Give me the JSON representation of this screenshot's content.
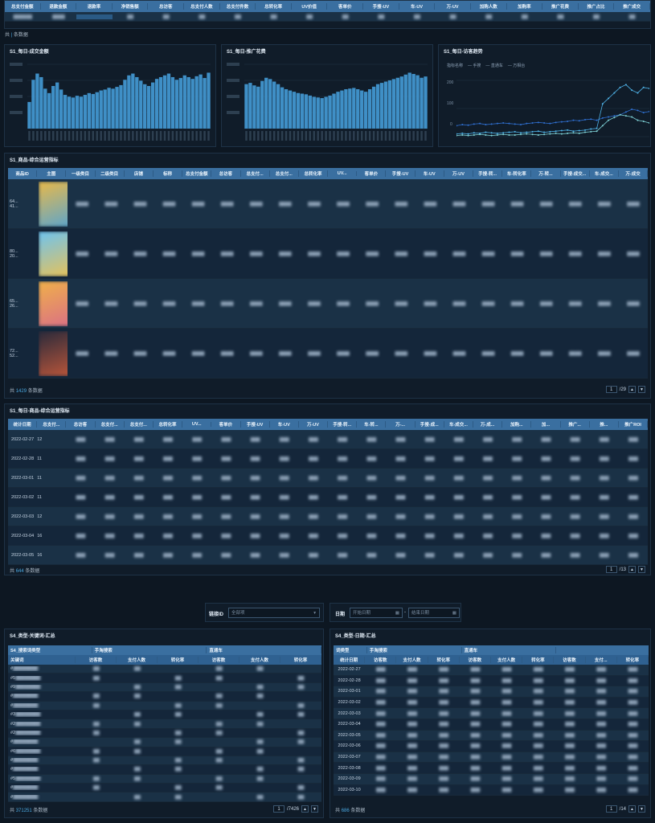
{
  "top_table": {
    "headers": [
      "总支付金额",
      "退款金额",
      "退款率",
      "净销售额",
      "总访客",
      "总支付人数",
      "总支付件数",
      "总转化率",
      "UV价值",
      "客单价",
      "手搜-UV",
      "车-UV",
      "万-UV",
      "加购人数",
      "加购率",
      "推广花费",
      "推广占比",
      "推广成交"
    ],
    "footer_prefix": "共",
    "footer_suffix": "条数据"
  },
  "chart1": {
    "title": "S1_每日-成交金额"
  },
  "chart2": {
    "title": "S1_每日-推广花费"
  },
  "chart3": {
    "title": "S1_每日-访客趋势",
    "legend_title": "指标名称",
    "legend": [
      "手搜",
      "直通车",
      "万相台"
    ],
    "y_ticks": [
      "0",
      "100",
      "200"
    ]
  },
  "chart_data": [
    {
      "type": "bar",
      "title": "S1_每日-成交金额",
      "values": [
        30,
        55,
        62,
        58,
        45,
        40,
        48,
        52,
        44,
        38,
        36,
        35,
        37,
        36,
        38,
        40,
        39,
        41,
        43,
        44,
        46,
        45,
        47,
        49,
        55,
        60,
        62,
        58,
        54,
        50,
        48,
        52,
        56,
        58,
        60,
        62,
        58,
        55,
        57,
        60,
        58,
        56,
        59,
        61,
        57,
        63
      ]
    },
    {
      "type": "bar",
      "title": "S1_每日-推广花费",
      "values": [
        70,
        72,
        68,
        66,
        75,
        80,
        78,
        74,
        70,
        65,
        62,
        60,
        58,
        56,
        55,
        54,
        52,
        50,
        49,
        48,
        50,
        52,
        55,
        58,
        60,
        62,
        63,
        64,
        62,
        60,
        58,
        62,
        66,
        70,
        72,
        74,
        76,
        78,
        80,
        82,
        85,
        88,
        86,
        84,
        80,
        82
      ]
    },
    {
      "type": "line",
      "title": "S1_每日-访客趋势",
      "series": [
        {
          "name": "手搜",
          "values": [
            20,
            22,
            21,
            23,
            24,
            22,
            23,
            24,
            25,
            24,
            23,
            22,
            24,
            25,
            26,
            25,
            24,
            26,
            27,
            28,
            30,
            29,
            31,
            32,
            30,
            34,
            36,
            38,
            40,
            45,
            50,
            48,
            44,
            46
          ]
        },
        {
          "name": "直通车",
          "values": [
            5,
            6,
            5,
            7,
            6,
            8,
            7,
            6,
            7,
            8,
            9,
            7,
            8,
            9,
            10,
            8,
            9,
            10,
            11,
            12,
            10,
            11,
            12,
            14,
            15,
            60,
            70,
            80,
            90,
            95,
            85,
            80,
            90,
            88
          ]
        },
        {
          "name": "万相台",
          "values": [
            2,
            3,
            2,
            3,
            4,
            3,
            2,
            3,
            4,
            3,
            3,
            4,
            5,
            4,
            3,
            4,
            5,
            6,
            5,
            6,
            7,
            6,
            8,
            9,
            10,
            20,
            30,
            35,
            40,
            38,
            36,
            30,
            28,
            25
          ]
        }
      ]
    }
  ],
  "goods_table": {
    "title": "S1_商品-综合运营指标",
    "headers": [
      "商品ID",
      "主图",
      "一级类目",
      "二级类目",
      "店铺",
      "标称",
      "总支付金额",
      "总访客",
      "总支付...",
      "总支付...",
      "总转化率",
      "UV...",
      "客单价",
      "手搜-UV",
      "车-UV",
      "万-UV",
      "手搜-转...",
      "车-转化率",
      "万-转...",
      "手搜-成交...",
      "车-成交...",
      "万-成交"
    ],
    "rows": [
      {
        "id": "64...\n41..."
      },
      {
        "id": "80...\n20..."
      },
      {
        "id": "65...\n26..."
      },
      {
        "id": "72...\n52..."
      }
    ],
    "footer_prefix": "共",
    "count": "1429",
    "footer_suffix": "条数据",
    "page": "1",
    "pages": "/29"
  },
  "daily_table": {
    "title": "S1_每日-商品-综合运营指标",
    "headers": [
      "统计日期",
      "总支付...",
      "总访客",
      "总支付...",
      "总支付...",
      "总转化率",
      "UV...",
      "客单价",
      "手搜-UV",
      "车-UV",
      "万-UV",
      "手搜-转...",
      "车-转...",
      "万-...",
      "手搜-成...",
      "车-成交...",
      "万-成...",
      "加购...",
      "加...",
      "推广...",
      "推...",
      "推广ROI"
    ],
    "rows": [
      {
        "date": "2022-02-27",
        "v": "12"
      },
      {
        "date": "2022-02-28",
        "v": "11"
      },
      {
        "date": "2022-03-01",
        "v": "11"
      },
      {
        "date": "2022-03-02",
        "v": "11"
      },
      {
        "date": "2022-03-03",
        "v": "12"
      },
      {
        "date": "2022-03-04",
        "v": "16"
      },
      {
        "date": "2022-03-05",
        "v": "16"
      }
    ],
    "footer_prefix": "共",
    "count": "644",
    "footer_suffix": "条数据",
    "page": "1",
    "pages": "/13"
  },
  "filters": {
    "link_label": "链接ID",
    "link_placeholder": "全部项",
    "date_label": "日期",
    "start_placeholder": "开始日期",
    "end_placeholder": "结束日期"
  },
  "kw_table": {
    "title": "S4_类型-关键词-汇总",
    "group_headers": [
      "S4_搜索词类型",
      "手淘搜索",
      "直通车"
    ],
    "sub_headers": [
      "关键词",
      "访客数",
      "支付人数",
      "转化率",
      "访客数",
      "支付人数",
      "转化率"
    ],
    "row_prefixes": [
      "#",
      "#5",
      "#9",
      "#",
      "#",
      "#3",
      "#2",
      "#2",
      "#",
      "#6",
      "#",
      "#",
      "#5",
      "#",
      "#"
    ],
    "footer_prefix": "共",
    "count": "371251",
    "footer_suffix": "条数据",
    "page": "1",
    "pages": "/7426"
  },
  "date_table": {
    "title": "S4_类型-日期-汇总",
    "group_headers": [
      "词类型",
      "手淘搜索",
      "直通车"
    ],
    "sub_headers": [
      "统计日期",
      "访客数",
      "支付人数",
      "转化率",
      "访客数",
      "支付人数",
      "转化率",
      "访客数",
      "支付...",
      "转化率"
    ],
    "dates": [
      "2022-02-27",
      "2022-02-28",
      "2022-03-01",
      "2022-03-02",
      "2022-03-03",
      "2022-03-04",
      "2022-03-05",
      "2022-03-06",
      "2022-03-07",
      "2022-03-08",
      "2022-03-09",
      "2022-03-10"
    ],
    "footer_prefix": "共",
    "count": "686",
    "footer_suffix": "条数据",
    "page": "1",
    "pages": "/14"
  }
}
